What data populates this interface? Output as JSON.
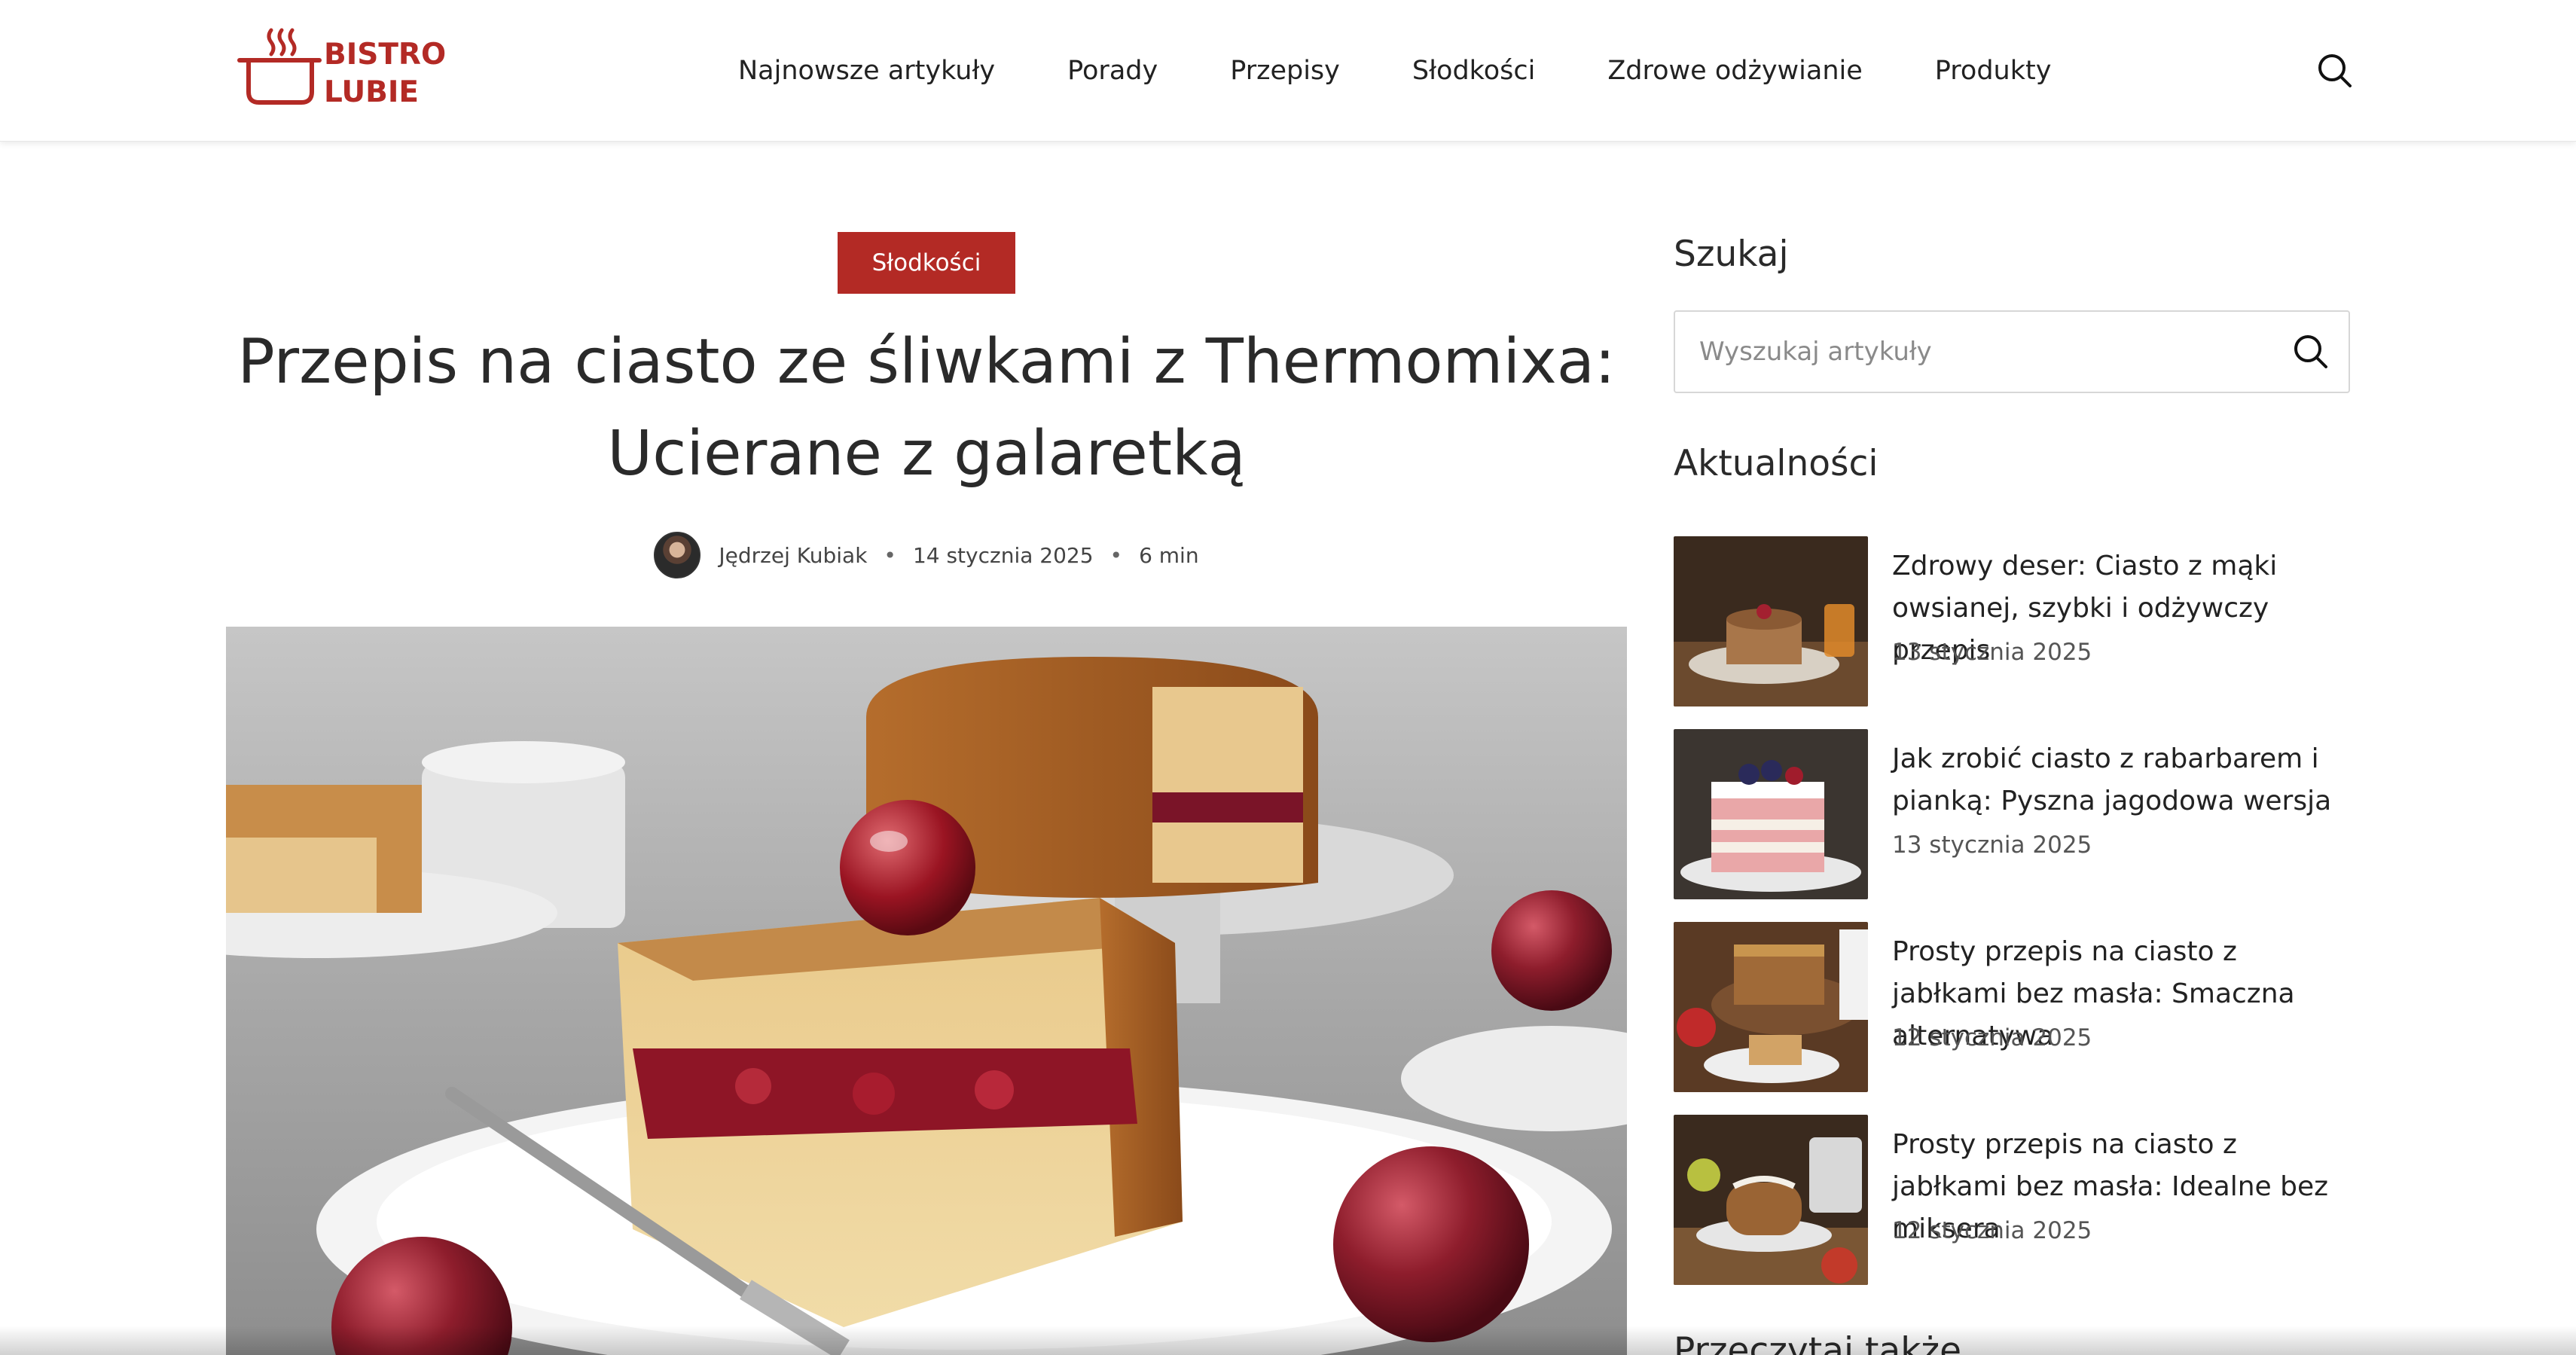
{
  "header": {
    "logo": {
      "line1": "BISTRO",
      "line2": "LUBIE"
    },
    "nav": [
      "Najnowsze artykuły",
      "Porady",
      "Przepisy",
      "Słodkości",
      "Zdrowe odżywianie",
      "Produkty"
    ],
    "search_icon": "search-icon"
  },
  "article": {
    "category": "Słodkości",
    "title": "Przepis na ciasto ze śliwkami z Thermomixa: Ucierane z galaretką",
    "author": "Jędrzej Kubiak",
    "date": "14 stycznia 2025",
    "read_time": "6 min",
    "meta_separator": "•"
  },
  "sidebar": {
    "search": {
      "heading": "Szukaj",
      "placeholder": "Wyszukaj artykuły"
    },
    "news": {
      "heading": "Aktualności",
      "items": [
        {
          "title": "Zdrowy deser: Ciasto z mąki owsianej, szybki i odżywczy przepis",
          "date": "13 stycznia 2025"
        },
        {
          "title": "Jak zrobić ciasto z rabarbarem i pianką: Pyszna jagodowa wersja",
          "date": "13 stycznia 2025"
        },
        {
          "title": "Prosty przepis na ciasto z jabłkami bez masła: Smaczna alternatywa",
          "date": "12 stycznia 2025"
        },
        {
          "title": "Prosty przepis na ciasto z jabłkami bez masła: Idealne bez miksera",
          "date": "12 stycznia 2025"
        }
      ]
    },
    "related_heading": "Przeczytaj także"
  },
  "colors": {
    "brand_red": "#b32a25",
    "text_dark": "#222222",
    "border": "#d7d7d7"
  }
}
